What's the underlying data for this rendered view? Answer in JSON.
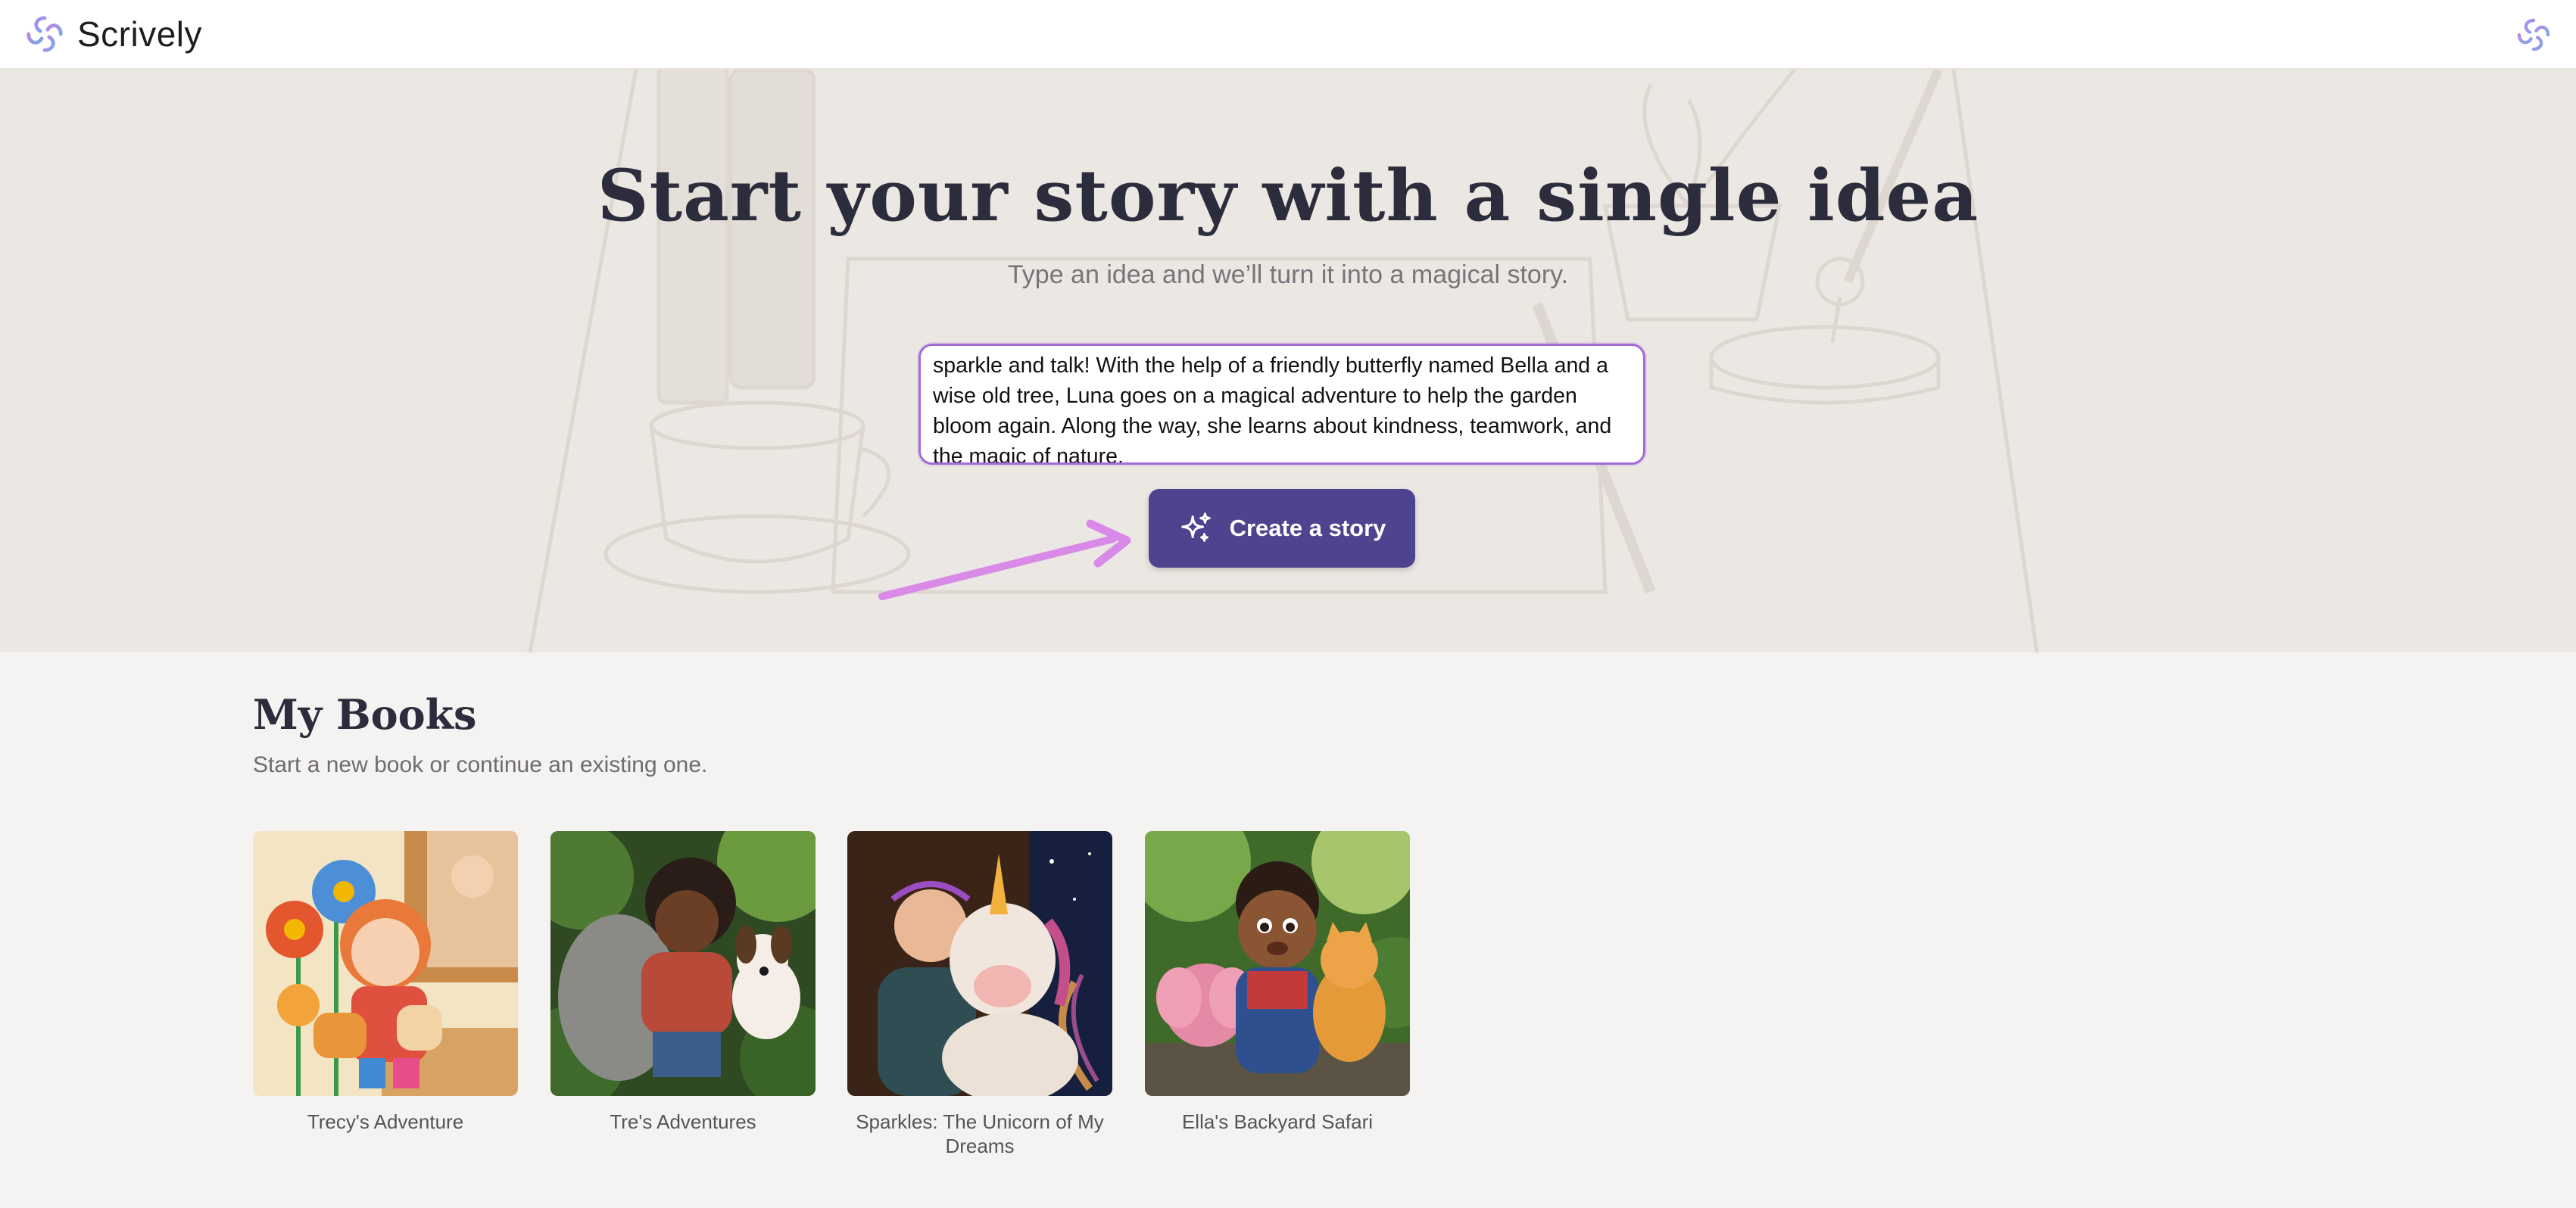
{
  "app": {
    "name": "Scrively"
  },
  "hero": {
    "title": "Start your story with a single idea",
    "subtitle": "Type an idea and we’ll turn it into a magical story.",
    "idea_text": "sparkle and talk! With the help of a friendly butterfly named Bella and a wise old tree, Luna goes on a magical adventure to help the garden bloom again. Along the way, she learns about kindness, teamwork, and the magic of nature.",
    "create_label": "Create a story"
  },
  "books": {
    "title": "My Books",
    "subtitle": "Start a new book or continue an existing one.",
    "items": [
      {
        "title": "Trecy's Adventure"
      },
      {
        "title": "Tre's Adventures"
      },
      {
        "title": "Sparkles: The Unicorn of My Dreams"
      },
      {
        "title": "Ella's Backyard Safari"
      }
    ]
  },
  "colors": {
    "accent": "#4e438f",
    "input_border": "#a46ad6",
    "arrow": "#d98ae8",
    "hero_bg": "#ebe7e2",
    "page_bg": "#f5f3f1"
  }
}
